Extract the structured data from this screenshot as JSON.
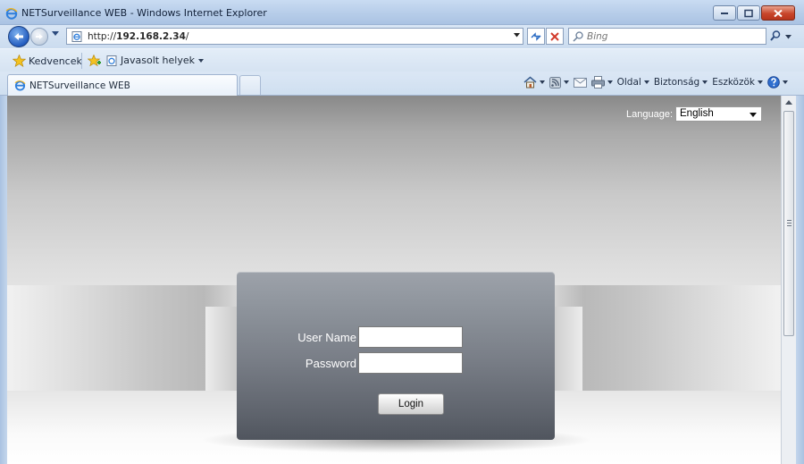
{
  "window": {
    "title": "NETSurveillance WEB - Windows Internet Explorer"
  },
  "address_bar": {
    "url_prefix": "http://",
    "url_host": "192.168.2.34",
    "url_suffix": "/"
  },
  "search": {
    "placeholder": "Bing"
  },
  "favorites_bar": {
    "favorites_label": "Kedvencek",
    "suggested_sites_label": "Javasolt helyek"
  },
  "tabs": [
    {
      "label": "NETSurveillance WEB"
    }
  ],
  "command_bar": {
    "page_label": "Oldal",
    "safety_label": "Biztonság",
    "tools_label": "Eszközök"
  },
  "page": {
    "language_label": "Language:",
    "language_value": "English",
    "username_label": "User Name",
    "password_label": "Password",
    "username_value": "",
    "password_value": "",
    "login_label": "Login"
  },
  "colors": {
    "ie_blue": "#245dc0",
    "panel_dark": "#50555e",
    "close_red": "#c8452a"
  },
  "icons": {
    "app": "ie-icon",
    "back": "back-arrow-icon",
    "forward": "forward-arrow-icon",
    "refresh": "refresh-icon",
    "stop": "stop-icon",
    "search": "search-icon",
    "favorites": "star-icon",
    "home": "home-icon",
    "feeds": "rss-icon",
    "mail": "mail-icon",
    "print": "print-icon",
    "help": "help-icon"
  }
}
